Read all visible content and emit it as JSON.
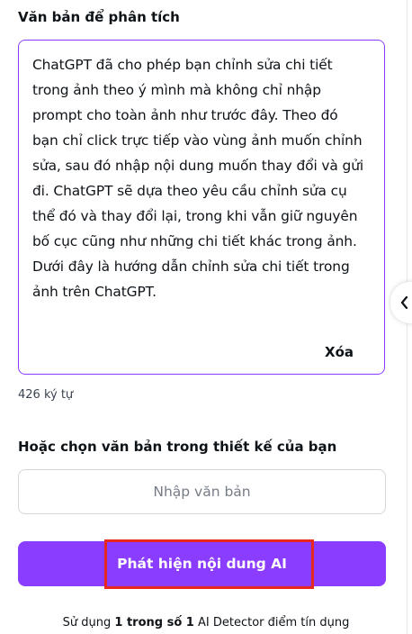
{
  "analyze_section": {
    "label": "Văn bản để phân tích",
    "text": "ChatGPT đã cho phép bạn chỉnh sửa chi tiết\ntrong ảnh theo ý mình mà không chỉ nhập\nprompt cho toàn ảnh như trước đây. Theo đó\nbạn chỉ click trực tiếp vào vùng ảnh muốn chỉnh\nsửa, sau đó nhập nội dung muốn thay đổi và gửi\nđi. ChatGPT sẽ dựa theo yêu cầu chỉnh sửa cụ\nthể đó và thay đổi lại, trong khi vẫn giữ nguyên\nbố cục cũng như những chi tiết khác trong ảnh.\nDưới đây là hướng dẫn chỉnh sửa chi tiết trong\nảnh trên ChatGPT.",
    "clear_label": "Xóa",
    "char_count": "426 ký tự"
  },
  "design_section": {
    "label": "Hoặc chọn văn bản trong thiết kế của bạn",
    "input_placeholder": "Nhập văn bản"
  },
  "detect_button": {
    "label": "Phát hiện nội dung AI"
  },
  "usage": {
    "prefix": "Sử dụng ",
    "count": "1 trong số 1",
    "suffix": " AI Detector điểm tín dụng"
  },
  "side_handle": {
    "icon": "chevron-left-icon"
  },
  "colors": {
    "accent": "#8b3dff",
    "highlight": "#e8281f",
    "text": "#0e1318",
    "muted": "#767c86"
  }
}
